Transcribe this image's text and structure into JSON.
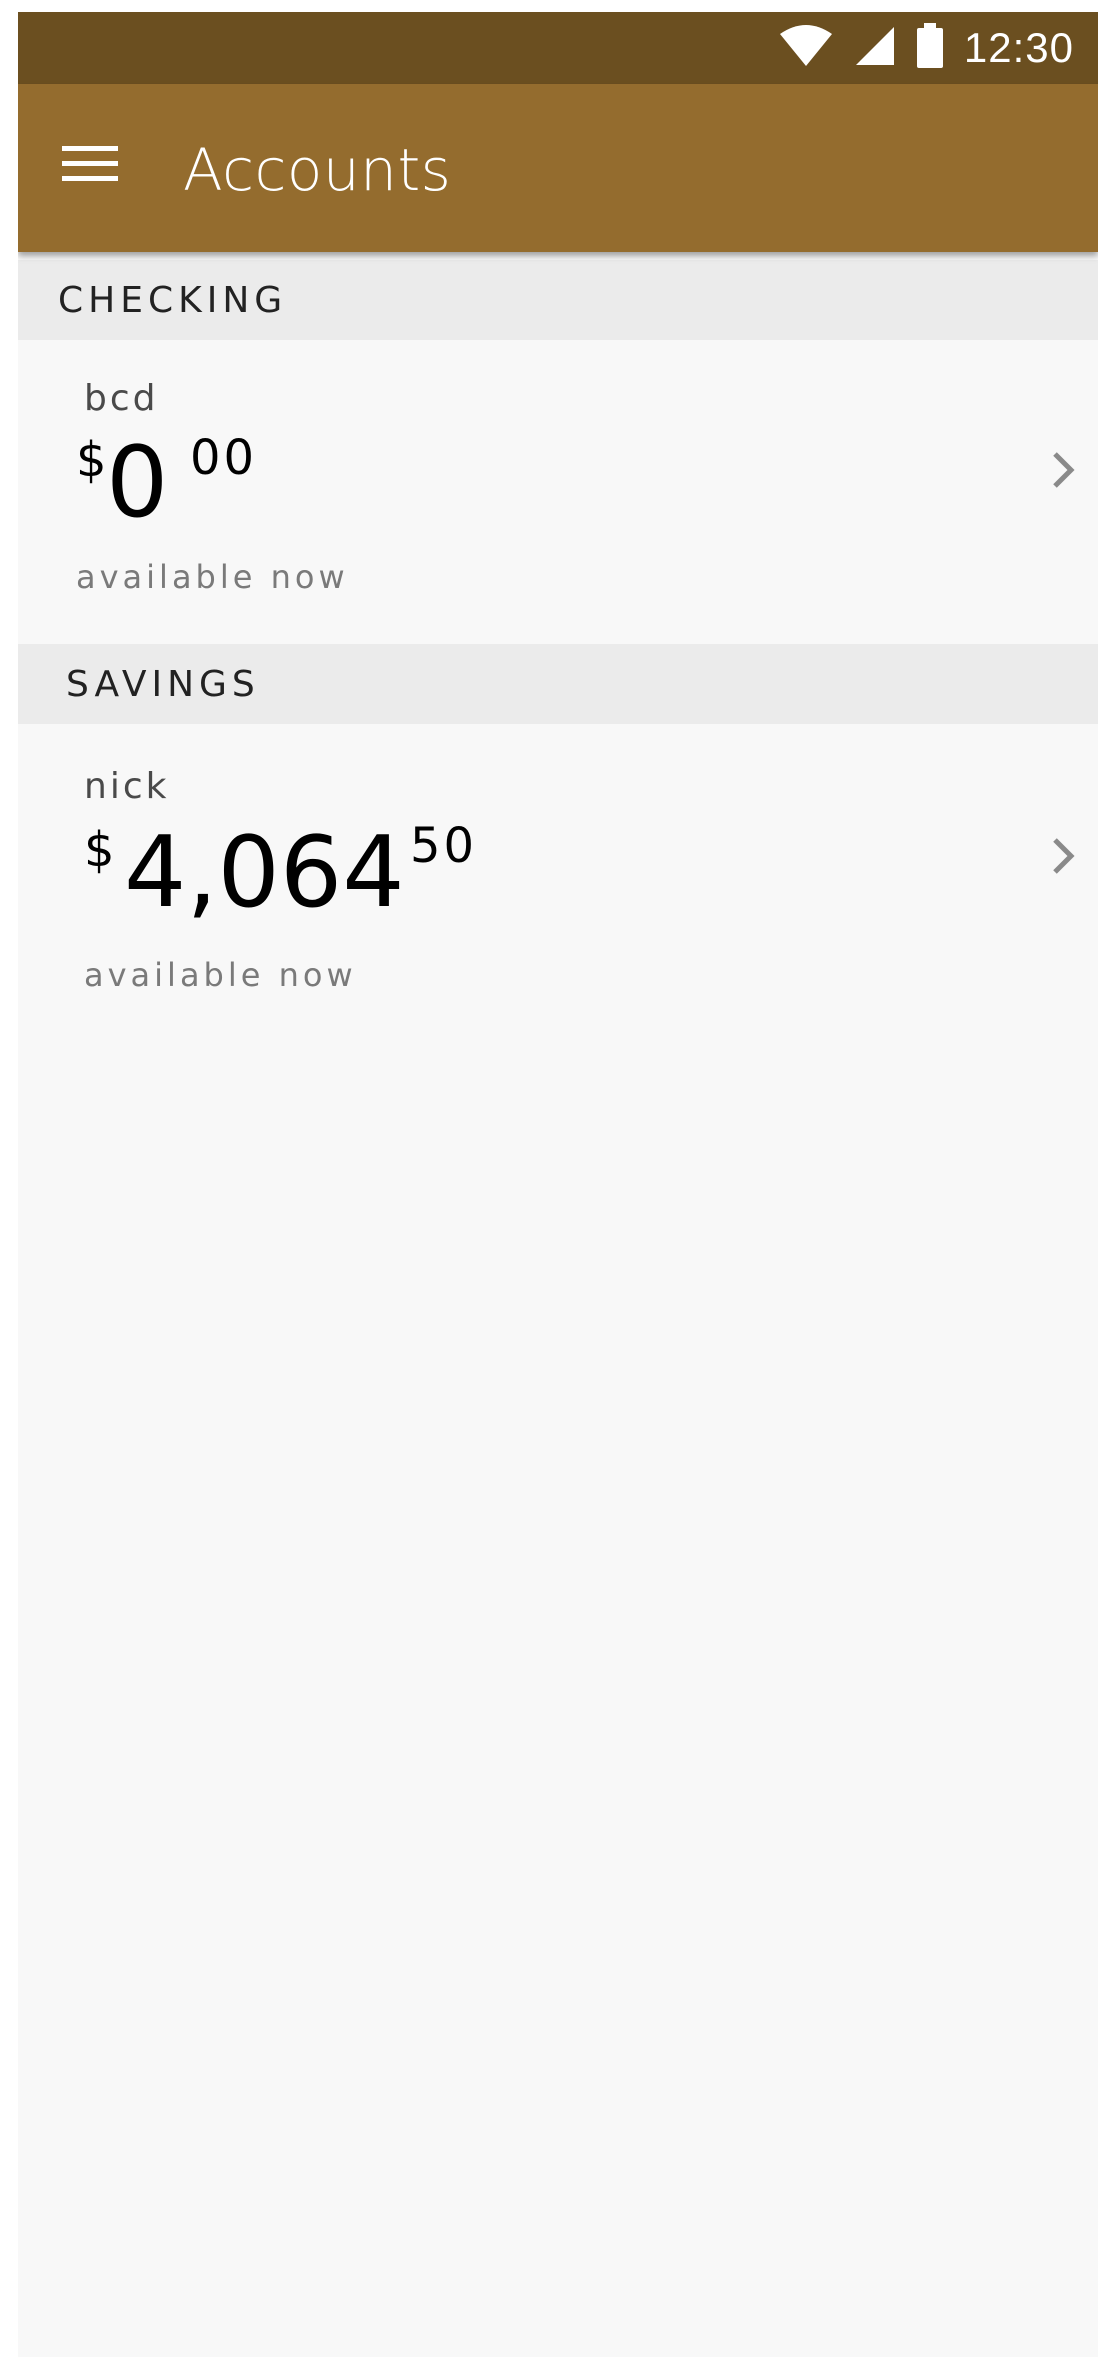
{
  "status_bar": {
    "time": "12:30",
    "icons": [
      "wifi-icon",
      "cell-signal-icon",
      "battery-icon"
    ]
  },
  "app_bar": {
    "title": "Accounts",
    "menu_icon": "hamburger-menu-icon"
  },
  "sections": [
    {
      "header": "CHECKING",
      "account": {
        "name": "bcd",
        "currency": "$",
        "whole": "0",
        "cents": "00",
        "availability": "available now"
      }
    },
    {
      "header": "SAVINGS",
      "account": {
        "name": "nick",
        "currency": "$",
        "whole": "4,064",
        "cents": "50",
        "availability": "available now"
      }
    }
  ],
  "colors": {
    "status_bar": "#6b4f20",
    "app_bar": "#946c2e",
    "section_header_bg": "#ebebeb",
    "content_bg": "#f8f8f8"
  }
}
